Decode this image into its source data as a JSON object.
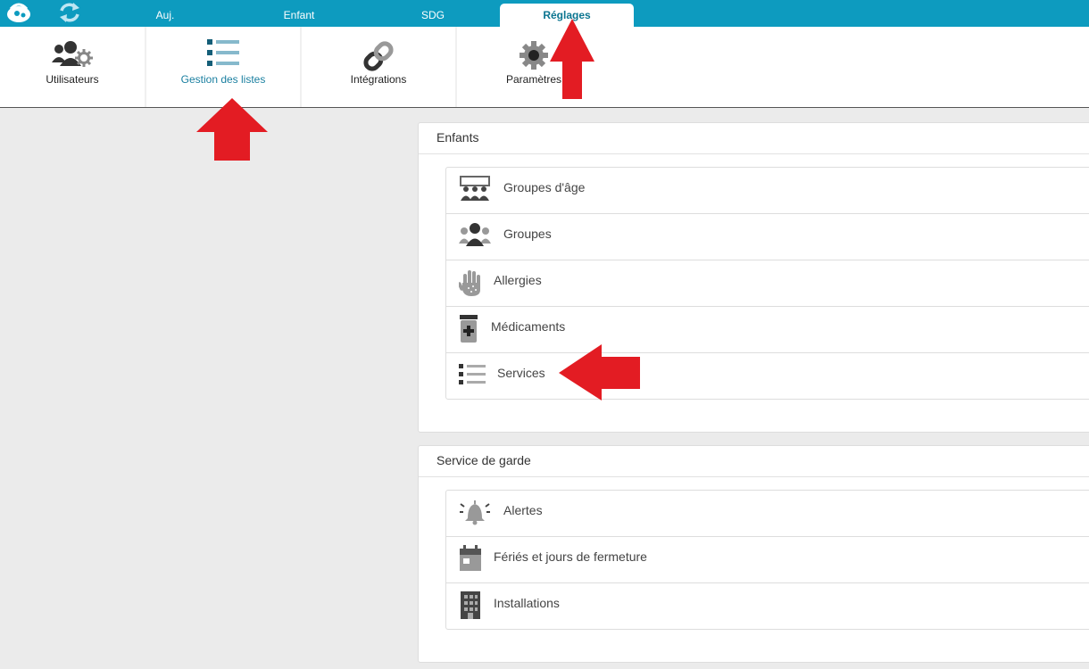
{
  "topbar": {
    "tabs": [
      "Auj.",
      "Enfant",
      "SDG",
      "Réglages"
    ],
    "active_tab": "Réglages"
  },
  "toolbar": {
    "users": "Utilisateurs",
    "lists": "Gestion des listes",
    "integrations": "Intégrations",
    "params": "Paramètres"
  },
  "enfants": {
    "title": "Enfants",
    "items": [
      "Groupes d'âge",
      "Groupes",
      "Allergies",
      "Médicaments",
      "Services"
    ]
  },
  "garde": {
    "title": "Service de garde",
    "items": [
      "Alertes",
      "Fériés et jours de fermeture",
      "Installations"
    ]
  },
  "colors": {
    "topbar": "#0d9bbf",
    "accent": "#1a7fa0",
    "arrow": "#e31c23"
  },
  "icons": [
    "logo-icon",
    "sync-icon",
    "users-gear-icon",
    "list-icon",
    "link-icon",
    "gear-icon",
    "classroom-icon",
    "group-icon",
    "hand-icon",
    "medicine-jar-icon",
    "bell-icon",
    "calendar-icon",
    "building-icon",
    "arrow-icon"
  ]
}
